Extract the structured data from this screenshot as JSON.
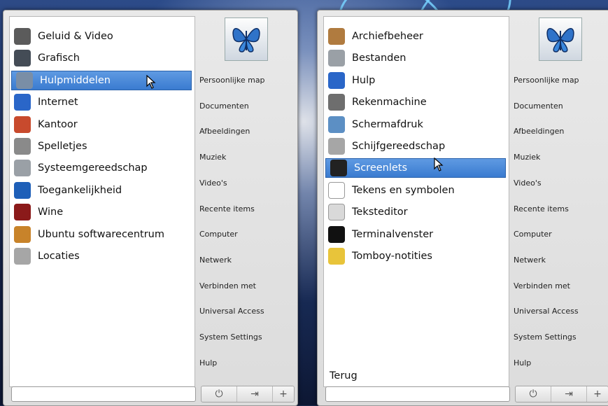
{
  "left_menu": {
    "categories": [
      {
        "label": "Geluid & Video",
        "icon": "headphones-icon",
        "color": "#5b5b5b"
      },
      {
        "label": "Grafisch",
        "icon": "camera-icon",
        "color": "#444c56"
      },
      {
        "label": "Hulpmiddelen",
        "icon": "tools-icon",
        "color": "#7a8ea6",
        "selected": true
      },
      {
        "label": "Internet",
        "icon": "globe-icon",
        "color": "#2a66c8"
      },
      {
        "label": "Kantoor",
        "icon": "books-icon",
        "color": "#c84a2d"
      },
      {
        "label": "Spelletjes",
        "icon": "gamepad-icon",
        "color": "#8a8a8a"
      },
      {
        "label": "Systeemgereedschap",
        "icon": "gears-icon",
        "color": "#9aa0a6"
      },
      {
        "label": "Toegankelijkheid",
        "icon": "accessibility-icon",
        "color": "#1e5fb8"
      },
      {
        "label": "Wine",
        "icon": "wine-glass-icon",
        "color": "#8b1a1a"
      },
      {
        "label": "Ubuntu softwarecentrum",
        "icon": "software-center-icon",
        "color": "#c8832a"
      },
      {
        "label": "Locaties",
        "icon": "drive-icon",
        "color": "#a6a6a6"
      }
    ]
  },
  "right_menu": {
    "apps": [
      {
        "label": "Archiefbeheer",
        "icon": "archive-icon",
        "color": "#b07b3f"
      },
      {
        "label": "Bestanden",
        "icon": "file-cabinet-icon",
        "color": "#9aa0a6"
      },
      {
        "label": "Hulp",
        "icon": "help-icon",
        "color": "#2a66c8"
      },
      {
        "label": "Rekenmachine",
        "icon": "calculator-icon",
        "color": "#6e6e6e"
      },
      {
        "label": "Schermafdruk",
        "icon": "screenshot-icon",
        "color": "#5c8fc4"
      },
      {
        "label": "Schijfgereedschap",
        "icon": "disk-utility-icon",
        "color": "#a6a6a6"
      },
      {
        "label": "Screenlets",
        "icon": "screenlets-icon",
        "color": "#222222",
        "selected": true
      },
      {
        "label": "Tekens en symbolen",
        "icon": "character-map-icon",
        "color": "#ffffff"
      },
      {
        "label": "Teksteditor",
        "icon": "text-editor-icon",
        "color": "#d9d9d9"
      },
      {
        "label": "Terminalvenster",
        "icon": "terminal-icon",
        "color": "#111111"
      },
      {
        "label": "Tomboy-notities",
        "icon": "notes-icon",
        "color": "#e8c43a"
      }
    ],
    "back_label": "Terug"
  },
  "places": [
    "Persoonlijke map",
    "Documenten",
    "Afbeeldingen",
    "Muziek",
    "Video's",
    "Recente items",
    "Computer",
    "Netwerk",
    "Verbinden met",
    "Universal Access",
    "System Settings",
    "Hulp"
  ],
  "buttons": {
    "power": "⏻",
    "logout": "⇥",
    "add": "+"
  },
  "colors": {
    "selection": "#3a7bd0",
    "panel": "#e2e2e2",
    "logo_butterfly": "#2f73c9"
  }
}
